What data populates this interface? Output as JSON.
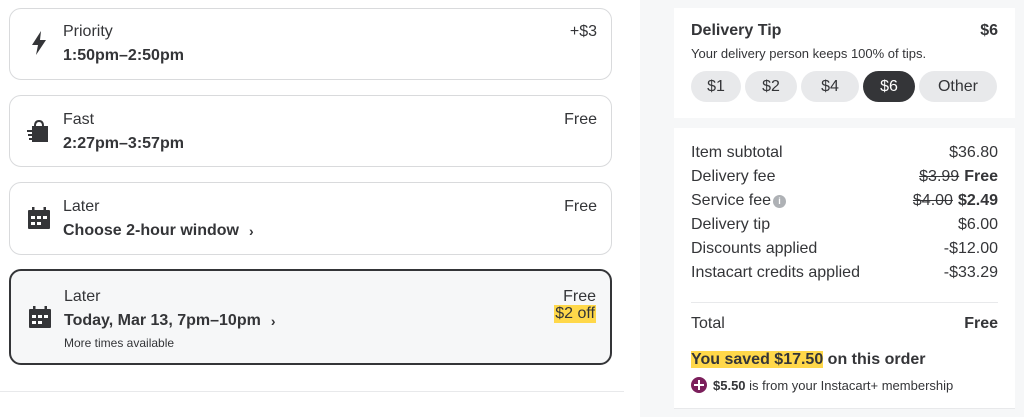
{
  "delivery_options": [
    {
      "label": "Priority",
      "time": "1:50pm–2:50pm",
      "price": "+$3",
      "icon": "lightning-icon"
    },
    {
      "label": "Fast",
      "time": "2:27pm–3:57pm",
      "price": "Free",
      "icon": "shopping-bag-icon"
    },
    {
      "label": "Later",
      "time": "Choose 2-hour window",
      "price": "Free",
      "icon": "calendar-icon",
      "chevron": "›"
    },
    {
      "label": "Later",
      "time": "Today, Mar 13, 7pm–10pm",
      "price": "Free",
      "promo": "$2 off",
      "sub": "More times available",
      "icon": "calendar-icon",
      "chevron": "›",
      "selected": true
    }
  ],
  "tip": {
    "title": "Delivery Tip",
    "amount": "$6",
    "subtitle": "Your delivery person keeps 100% of tips.",
    "options": [
      "$1",
      "$2",
      "$4",
      "$6",
      "Other"
    ],
    "selected": "$6"
  },
  "summary": {
    "item_subtotal_label": "Item subtotal",
    "item_subtotal_value": "$36.80",
    "delivery_fee_label": "Delivery fee",
    "delivery_fee_original": "$3.99",
    "delivery_fee_value": "Free",
    "service_fee_label": "Service fee",
    "service_fee_original": "$4.00",
    "service_fee_value": "$2.49",
    "delivery_tip_label": "Delivery tip",
    "delivery_tip_value": "$6.00",
    "discounts_label": "Discounts applied",
    "discounts_value": "-$12.00",
    "credits_label": "Instacart credits applied",
    "credits_value": "-$33.29",
    "total_label": "Total",
    "total_value": "Free",
    "saved_highlight": "You saved $17.50",
    "saved_rest": " on this order",
    "membership_amount": "$5.50",
    "membership_text": " is from your Instacart+ membership"
  },
  "colors": {
    "text": "#343538",
    "highlight": "#ffd84a",
    "selected_chip": "#343538",
    "chip": "#e8e9eb",
    "membership_badge": "#7b1f5b"
  }
}
